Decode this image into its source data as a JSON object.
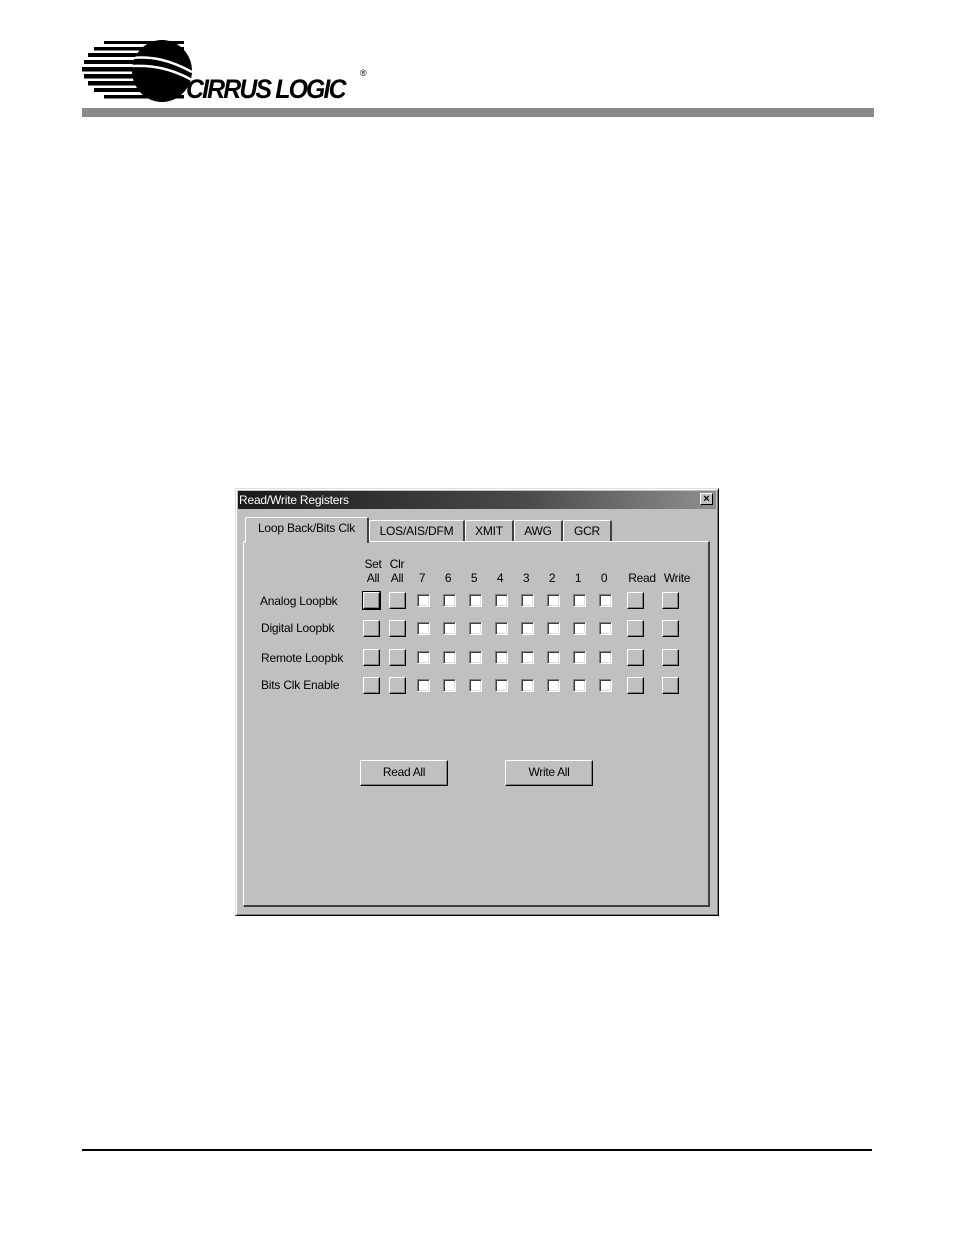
{
  "brand": {
    "name": "CIRRUS LOGIC",
    "registered_mark": "®"
  },
  "window": {
    "title": "Read/Write Registers",
    "close_label": "×"
  },
  "tabs": [
    {
      "label": "Loop Back/Bits Clk",
      "active": true
    },
    {
      "label": "LOS/AIS/DFM",
      "active": false
    },
    {
      "label": "XMIT",
      "active": false
    },
    {
      "label": "AWG",
      "active": false
    },
    {
      "label": "GCR",
      "active": false
    }
  ],
  "grid": {
    "columns": {
      "set_all": {
        "line1": "Set",
        "line2": "All"
      },
      "clr_all": {
        "line1": "Clr",
        "line2": "All"
      },
      "bits": [
        "7",
        "6",
        "5",
        "4",
        "3",
        "2",
        "1",
        "0"
      ],
      "read": "Read",
      "write": "Write"
    },
    "rows": [
      {
        "label": "Analog Loopbk"
      },
      {
        "label": "Digital Loopbk"
      },
      {
        "label": "Remote Loopbk"
      },
      {
        "label": "Bits Clk Enable"
      }
    ]
  },
  "actions": {
    "read_all": "Read All",
    "write_all": "Write All"
  }
}
